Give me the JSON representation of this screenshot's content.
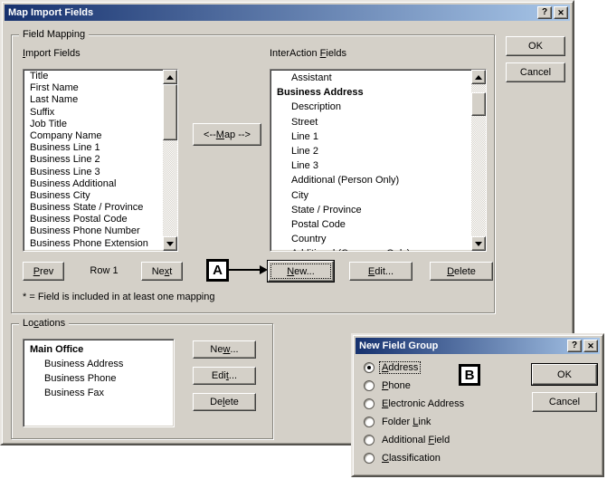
{
  "colors": {
    "dialog_face": "#D4D0C8",
    "titlebar_gradient_left": "#16316E",
    "titlebar_gradient_right": "#A8C6E8",
    "titlebar_text": "#FFFFFF",
    "list_background": "#FFFFFF",
    "callout_border": "#000000"
  },
  "glyphs": {
    "help": "?",
    "close": "✕"
  },
  "main_dialog": {
    "title": "Map Import Fields",
    "ok_label": "OK",
    "cancel_label": "Cancel",
    "field_mapping": {
      "group_label": "Field Mapping",
      "import_label": {
        "pre": "",
        "key": "I",
        "post": "mport Fields"
      },
      "interaction_label": {
        "pre": "InterAction ",
        "key": "F",
        "post": "ields"
      },
      "import_items": [
        "Title",
        "First Name",
        "Last Name",
        "Suffix",
        "Job Title",
        "Company Name",
        "Business Line 1",
        "Business Line 2",
        "Business Line 3",
        "Business Additional",
        "Business City",
        "Business State / Province",
        "Business Postal Code",
        "Business Phone Number",
        "Business Phone Extension"
      ],
      "interaction_items": [
        {
          "text": "Assistant",
          "bold": false,
          "indent": true
        },
        {
          "text": "Business Address",
          "bold": true,
          "indent": false
        },
        {
          "text": "Description",
          "bold": false,
          "indent": true
        },
        {
          "text": "Street",
          "bold": false,
          "indent": true
        },
        {
          "text": "Line 1",
          "bold": false,
          "indent": true
        },
        {
          "text": "Line 2",
          "bold": false,
          "indent": true
        },
        {
          "text": "Line 3",
          "bold": false,
          "indent": true
        },
        {
          "text": "Additional (Person Only)",
          "bold": false,
          "indent": true
        },
        {
          "text": "City",
          "bold": false,
          "indent": true
        },
        {
          "text": "State / Province",
          "bold": false,
          "indent": true
        },
        {
          "text": "Postal Code",
          "bold": false,
          "indent": true
        },
        {
          "text": "Country",
          "bold": false,
          "indent": true
        },
        {
          "text": "Additional (Company Only)",
          "bold": false,
          "indent": true
        }
      ],
      "map_button": {
        "pre": "<-- ",
        "key": "M",
        "post": "ap -->"
      },
      "prev_button": {
        "pre": "",
        "key": "P",
        "post": "rev"
      },
      "row_label": "Row 1",
      "next_button": {
        "pre": "Ne",
        "key": "x",
        "post": "t"
      },
      "new_button": {
        "pre": "",
        "key": "N",
        "post": "ew..."
      },
      "edit_button": {
        "pre": "",
        "key": "E",
        "post": "dit..."
      },
      "delete_button": {
        "pre": "",
        "key": "D",
        "post": "elete"
      },
      "note": "* = Field is included in at least one mapping",
      "callout_a": "A"
    },
    "locations": {
      "group_label": {
        "pre": "Lo",
        "key": "c",
        "post": "ations"
      },
      "items": [
        {
          "text": "Main Office",
          "bold": true,
          "indent": false
        },
        {
          "text": "Business Address",
          "bold": false,
          "indent": true
        },
        {
          "text": "Business Phone",
          "bold": false,
          "indent": true
        },
        {
          "text": "Business Fax",
          "bold": false,
          "indent": true
        }
      ],
      "new_button": {
        "pre": "Ne",
        "key": "w",
        "post": "..."
      },
      "edit_button": {
        "pre": "Edi",
        "key": "t",
        "post": "..."
      },
      "delete_button": {
        "pre": "De",
        "key": "l",
        "post": "ete"
      }
    }
  },
  "new_field_group": {
    "title": "New Field Group",
    "callout_b": "B",
    "options": [
      {
        "pre": "",
        "key": "A",
        "post": "ddress",
        "selected": true
      },
      {
        "pre": "",
        "key": "P",
        "post": "hone",
        "selected": false
      },
      {
        "pre": "",
        "key": "E",
        "post": "lectronic Address",
        "selected": false
      },
      {
        "pre": "Folder ",
        "key": "L",
        "post": "ink",
        "selected": false
      },
      {
        "pre": "Additional ",
        "key": "F",
        "post": "ield",
        "selected": false
      },
      {
        "pre": "",
        "key": "C",
        "post": "lassification",
        "selected": false
      }
    ],
    "ok_label": "OK",
    "cancel_label": "Cancel"
  }
}
